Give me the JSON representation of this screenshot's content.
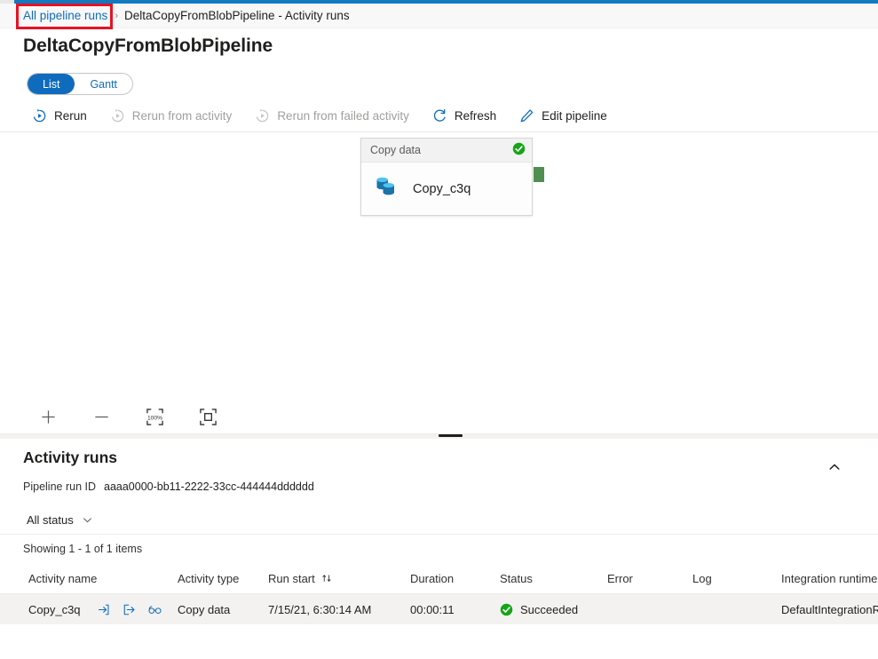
{
  "breadcrumb": {
    "link": "All pipeline runs",
    "separator": "›",
    "current": "DeltaCopyFromBlobPipeline - Activity runs"
  },
  "page": {
    "title": "DeltaCopyFromBlobPipeline"
  },
  "pivot": {
    "list": "List",
    "gantt": "Gantt",
    "selected": "List"
  },
  "toolbar": {
    "rerun": "Rerun",
    "rerun_from_activity": "Rerun from activity",
    "rerun_from_failed_activity": "Rerun from failed activity",
    "refresh": "Refresh",
    "edit_pipeline": "Edit pipeline"
  },
  "canvas": {
    "node": {
      "header": "Copy data",
      "label": "Copy_c3q",
      "status": "succeeded",
      "status_color": "#107c10"
    },
    "zoom": {
      "zoom_in": "+",
      "zoom_out": "—",
      "reset_label": "100%",
      "fit_label": "Fit to screen"
    }
  },
  "panel": {
    "title": "Activity runs",
    "run_id_label": "Pipeline run ID",
    "run_id_value": "aaaa0000-bb11-2222-33cc-444444dddddd",
    "status_filter": "All status",
    "showing": "Showing 1 - 1 of 1 items",
    "collapse_label": "Collapse"
  },
  "table": {
    "columns": [
      "Activity name",
      "Activity type",
      "Run start",
      "Duration",
      "Status",
      "Error",
      "Log",
      "Integration runtime"
    ],
    "sorted_column": "Run start",
    "rows": [
      {
        "activity_name": "Copy_c3q",
        "activity_type": "Copy data",
        "run_start": "7/15/21, 6:30:14 AM",
        "duration": "00:00:11",
        "status": "Succeeded",
        "error": "",
        "log": "",
        "integration_runtime": "DefaultIntegrationRuntime"
      }
    ]
  },
  "colors": {
    "accent": "#0f6cbd",
    "success": "#107c10",
    "annotation": "#e81123"
  }
}
